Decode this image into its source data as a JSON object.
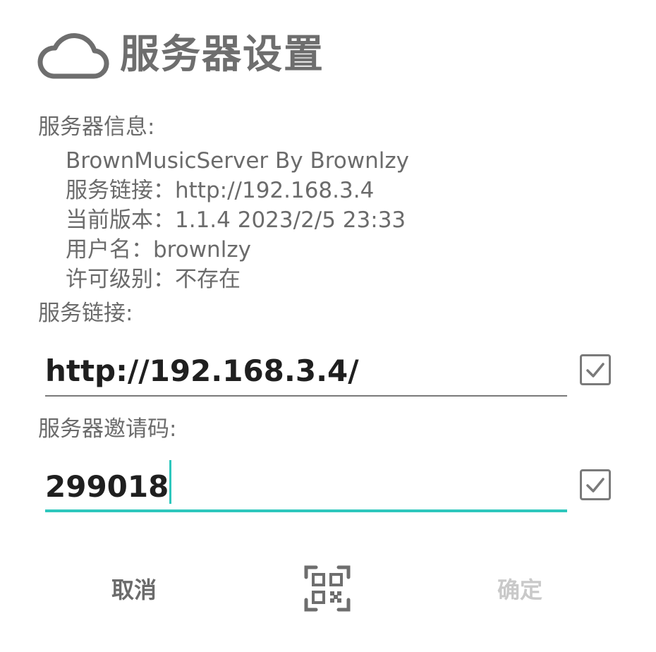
{
  "dialog": {
    "title": "服务器设置",
    "icon": "cloud-icon"
  },
  "server_info": {
    "label": "服务器信息:",
    "lines": [
      "BrownMusicServer By Brownlzy",
      "服务链接：http://192.168.3.4",
      "当前版本：1.1.4 2023/2/5 23:33",
      "用户名：brownlzy",
      "许可级别：不存在"
    ]
  },
  "server_link": {
    "label": "服务链接:",
    "value": "http://192.168.3.4/",
    "checked": true
  },
  "invite_code": {
    "label": "服务器邀请码:",
    "value": "299018",
    "checked": true
  },
  "buttons": {
    "cancel_label": "取消",
    "qr_icon": "qr-code-icon",
    "ok_label": "确定"
  },
  "colors": {
    "accent": "#2ec7bd",
    "text": "#6b6b6b",
    "disabled": "#c9c9c9"
  }
}
